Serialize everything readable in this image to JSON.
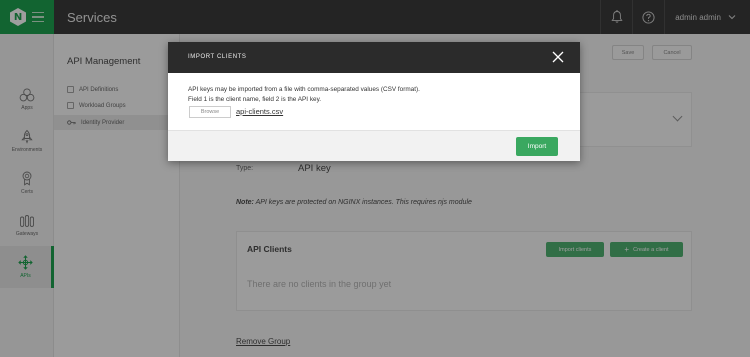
{
  "topbar": {
    "logo_letter": "N",
    "title": "Services",
    "user": "admin admin"
  },
  "leftnav": {
    "items": [
      {
        "label": "Apps",
        "icon": "apps-icon"
      },
      {
        "label": "Environments",
        "icon": "environments-icon"
      },
      {
        "label": "Certs",
        "icon": "certs-icon"
      },
      {
        "label": "Gateways",
        "icon": "gateways-icon"
      },
      {
        "label": "APIs",
        "icon": "apis-icon",
        "active": true
      }
    ]
  },
  "subnav": {
    "title": "API Management",
    "items": [
      {
        "label": "API Definitions"
      },
      {
        "label": "Workload Groups"
      },
      {
        "label": "Identity Provider",
        "active": true
      }
    ]
  },
  "main": {
    "save_label": "Save",
    "cancel_label": "Cancel",
    "type_label": "Type:",
    "type_value": "API key",
    "note_prefix": "Note:",
    "note_text": " API keys are protected on NGINX instances. This requires njs module",
    "clients_title": "API Clients",
    "import_clients_label": "Import clients",
    "create_client_label": "Create a client",
    "empty_text": "There are no clients in the group yet",
    "remove_group_label": "Remove Group"
  },
  "modal": {
    "title": "IMPORT CLIENTS",
    "description_line1": "API keys may be imported from a file with comma-separated values (CSV format).",
    "description_line2": "Field 1 is the client name, field 2 is the API key.",
    "browse_label": "Browse",
    "file_name": "api-clients.csv",
    "import_label": "Import"
  },
  "colors": {
    "brand_green": "#009639",
    "button_green": "#3aa860",
    "topbar": "#222222"
  }
}
